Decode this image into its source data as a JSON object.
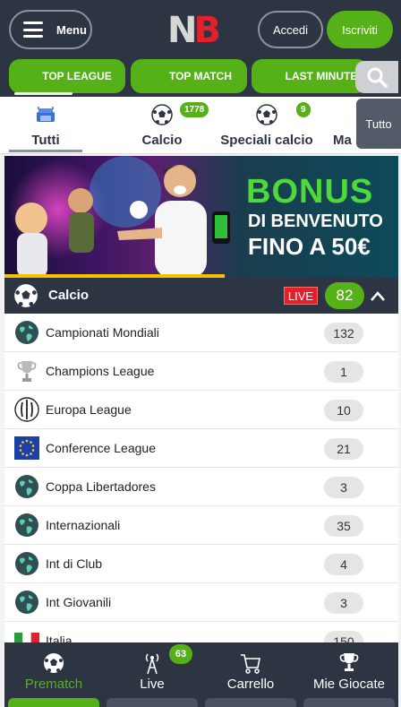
{
  "header": {
    "menu_label": "Menu",
    "logo_n": "N",
    "logo_b": "B",
    "login_label": "Accedi",
    "signup_label": "Iscriviti"
  },
  "quick_links": [
    "TOP LEAGUE",
    "TOP MATCH",
    "LAST MINUTE"
  ],
  "sport_tabs": [
    {
      "label": "Tutti",
      "badge": ""
    },
    {
      "label": "Calcio",
      "badge": "1778"
    },
    {
      "label": "Speciali calcio",
      "badge": "9"
    },
    {
      "label": "Ma",
      "badge": ""
    }
  ],
  "tutto_label": "Tutto",
  "banner": {
    "headline": "BONUS",
    "line2": "DI BENVENUTO",
    "line3": "FINO A 50€"
  },
  "section": {
    "title": "Calcio",
    "live_label": "LIVE",
    "count": "82"
  },
  "competitions": [
    {
      "name": "Campionati Mondiali",
      "count": "132",
      "icon": "globe-icon"
    },
    {
      "name": "Champions League",
      "count": "1",
      "icon": "trophy-icon"
    },
    {
      "name": "Europa League",
      "count": "10",
      "icon": "europa-league-icon"
    },
    {
      "name": "Conference League",
      "count": "21",
      "icon": "eu-flag-icon"
    },
    {
      "name": "Coppa Libertadores",
      "count": "3",
      "icon": "globe-icon"
    },
    {
      "name": "Internazionali",
      "count": "35",
      "icon": "globe-icon"
    },
    {
      "name": "Int di Club",
      "count": "4",
      "icon": "globe-icon"
    },
    {
      "name": "Int Giovanili",
      "count": "3",
      "icon": "globe-icon"
    },
    {
      "name": "Italia",
      "count": "150",
      "icon": "italy-flag-icon"
    }
  ],
  "bottom_nav": {
    "items": [
      {
        "label": "Prematch",
        "active": true
      },
      {
        "label": "Live",
        "active": false
      },
      {
        "label": "Carrello",
        "active": false
      },
      {
        "label": "Mie Giocate",
        "active": false
      }
    ],
    "live_badge": "63"
  },
  "colors": {
    "dark": "#2e3542",
    "green": "#55b117",
    "red": "#e3202b"
  }
}
